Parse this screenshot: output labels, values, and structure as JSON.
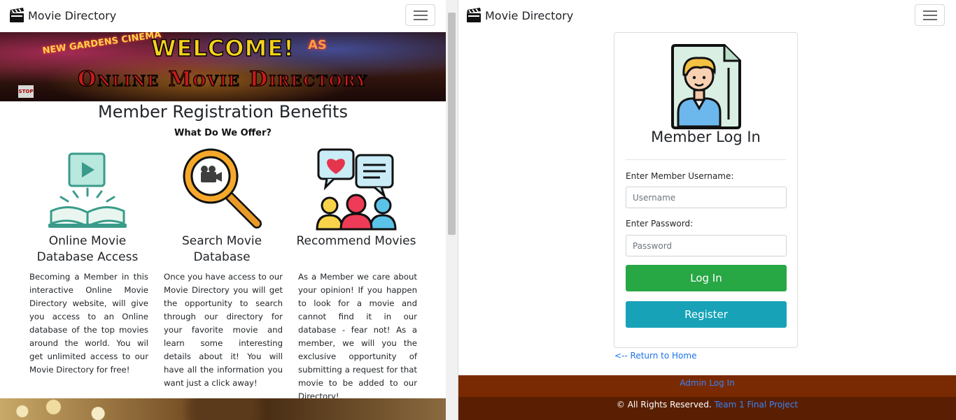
{
  "left_page": {
    "navbar": {
      "brand": "Movie Directory",
      "brand_icon": "clapperboard-icon",
      "toggle_icon": "hamburger-menu-icon"
    },
    "banner": {
      "welcome": "WELCOME!",
      "title": "Online Movie Directory",
      "sign_left": "NEW GARDENS CINEMA",
      "sign_right": "AS",
      "stop": "STOP"
    },
    "benefits": {
      "heading": "Member Registration Benefits",
      "subheading": "What Do We Offer?",
      "items": [
        {
          "icon": "open-book-play-icon",
          "title": "Online Movie Database Access",
          "text": "Becoming a Member in this interactive Online Movie Directory website, will give you access to an Online database of the top movies around the world. You wil get unlimited access to our Movie Directory for free!"
        },
        {
          "icon": "magnifier-camera-icon",
          "title": "Search Movie Database",
          "text": "Once you have access to our Movie Directory you will get the opportunity to search through our directory for your favorite movie and learn some interesting details about it! You will have all the information you want just a click away!"
        },
        {
          "icon": "people-chat-icon",
          "title": "Recommend Movies",
          "text": "As a Member we care about your opinion! If you happen to look for a movie and cannot find it in our database - fear not! As a member, we will you the exclusive opportunity of submitting a request for that movie to be added to our Directory!"
        }
      ]
    }
  },
  "right_page": {
    "navbar": {
      "brand": "Movie Directory",
      "brand_icon": "clapperboard-icon",
      "toggle_icon": "hamburger-menu-icon"
    },
    "login": {
      "avatar_icon": "member-card-icon",
      "title": "Member Log In",
      "username_label": "Enter Member Username:",
      "username_placeholder": "Username",
      "username_value": "",
      "password_label": "Enter Password:",
      "password_placeholder": "Password",
      "password_value": "",
      "login_button": "Log In",
      "register_button": "Register"
    },
    "return_link": "<-- Return to Home",
    "admin_link": "Admin Log In",
    "footer": {
      "text": "© All Rights Reserved. ",
      "link": "Team 1 Final Project"
    },
    "colors": {
      "login": "#28a745",
      "register": "#17a2b8",
      "admin_bar": "#7a2a02",
      "footer_bar": "#5a1f02",
      "link": "#3b82f6"
    }
  }
}
